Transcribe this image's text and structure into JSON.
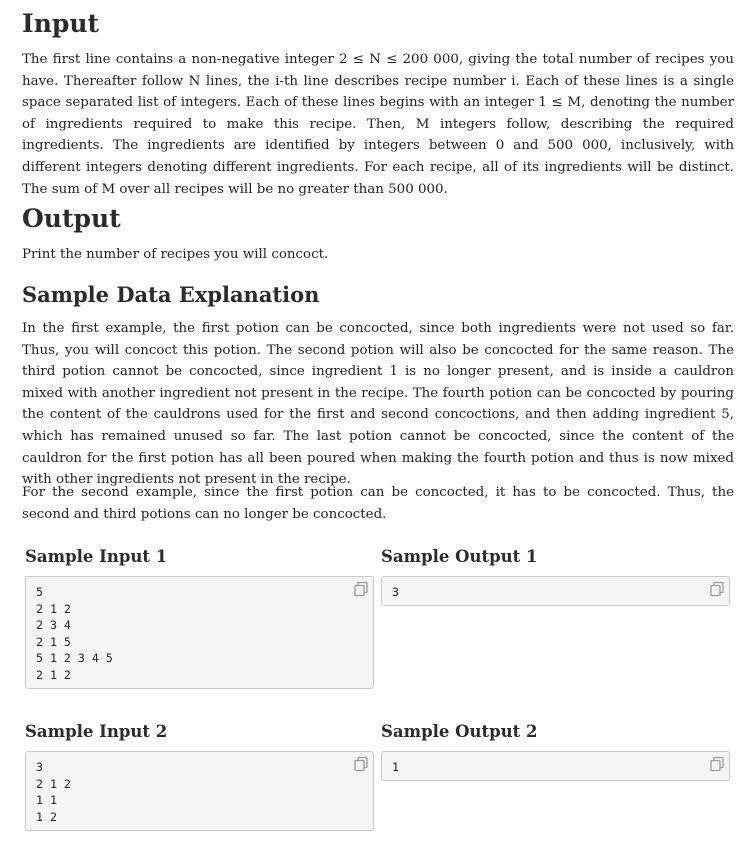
{
  "input_section": {
    "heading": "Input",
    "text": "The first line contains a non-negative integer 2 ≤ N ≤ 200 000, giving the total number of recipes you have. Thereafter follow N lines, the i-th line describes recipe number i. Each of these lines is a single space separated list of integers. Each of these lines begins with an integer 1 ≤ M, denoting the number of ingredients required to make this recipe. Then, M integers follow, describing the required ingredients. The ingredients are identified by integers between 0 and 500 000, inclusively, with different integers denoting different ingredients. For each recipe, all of its ingredients will be distinct. The sum of M over all recipes will be no greater than 500 000."
  },
  "output_section": {
    "heading": "Output",
    "text": "Print the number of recipes you will concoct."
  },
  "explanation_section": {
    "heading": "Sample Data Explanation",
    "paragraph1": "In the first example, the first potion can be concocted, since both ingredients were not used so far. Thus, you will concoct this potion. The second potion will also be concocted for the same reason. The third potion cannot be concocted, since ingredient 1 is no longer present, and is inside a cauldron mixed with another ingredient not present in the recipe. The fourth potion can be concocted by pouring the content of the cauldrons used for the first and second concoctions, and then adding ingredient 5, which has remained unused so far. The last potion cannot be concocted, since the content of the cauldron for the first potion has all been poured when making the fourth potion and thus is now mixed with other ingredients not present in the recipe.",
    "paragraph2": "For the second example, since the first potion can be concocted, it has to be concocted. Thus, the second and third potions can no longer be concocted."
  },
  "samples": [
    {
      "input_title": "Sample Input 1",
      "input": "5\n2 1 2\n2 3 4\n2 1 5\n5 1 2 3 4 5\n2 1 2",
      "output_title": "Sample Output 1",
      "output": "3"
    },
    {
      "input_title": "Sample Input 2",
      "input": "3\n2 1 2\n1 1\n1 2",
      "output_title": "Sample Output 2",
      "output": "1"
    }
  ],
  "icons": {
    "copy": "copy-icon"
  }
}
